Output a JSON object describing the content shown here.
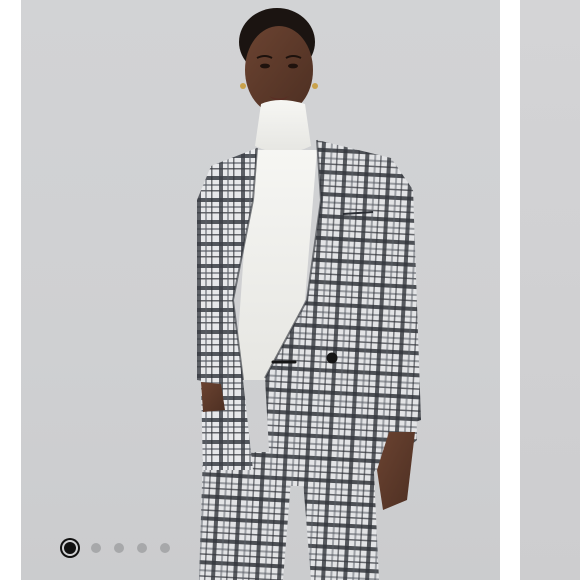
{
  "carousel": {
    "slide_count": 5,
    "active_index": 0,
    "colors": {
      "background": "#cfd0d2",
      "dot_active": "#111111",
      "dot_inactive": "#a7a8aa"
    }
  },
  "photo": {
    "subject": "model-wearing-plaid-blazer-and-white-turtleneck"
  }
}
